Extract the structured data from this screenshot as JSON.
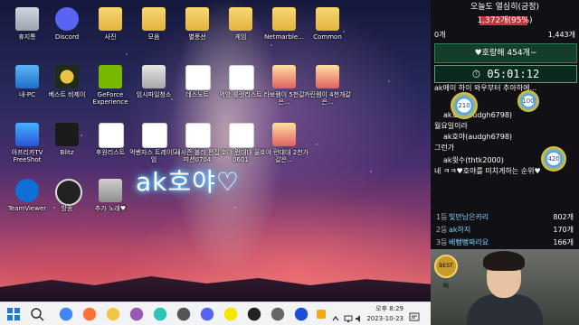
{
  "desktop": {
    "icons": [
      {
        "label": "휴지통",
        "icon": "recycle-bin-icon"
      },
      {
        "label": "Discord",
        "icon": "discord-icon"
      },
      {
        "label": "사진",
        "icon": "folder-icon"
      },
      {
        "label": "모음",
        "icon": "folder-icon"
      },
      {
        "label": "별풍선",
        "icon": "folder-icon"
      },
      {
        "label": "게임",
        "icon": "folder-icon"
      },
      {
        "label": "Netmarble...",
        "icon": "folder-icon"
      },
      {
        "label": "Common",
        "icon": "folder-icon"
      },
      {
        "label": "내-PC",
        "icon": "pc-icon"
      },
      {
        "label": "베스트 비제이",
        "icon": "medal-icon"
      },
      {
        "label": "GeForce Experience",
        "icon": "nvidia-icon"
      },
      {
        "label": "임시파일청소",
        "icon": "trash-icon"
      },
      {
        "label": "데스노트",
        "icon": "document-icon"
      },
      {
        "label": "먹방 룰렛리스트",
        "icon": "document-icon"
      },
      {
        "label": "라보렘이 5천갈은...",
        "icon": "image-icon"
      },
      {
        "label": "카린렘이 4천개갈은...",
        "icon": "image-icon"
      },
      {
        "label": "아프리카TV FreeShot",
        "icon": "pdf-icon"
      },
      {
        "label": "Blitz",
        "icon": "blitz-icon"
      },
      {
        "label": "후원리스트",
        "icon": "document-icon"
      },
      {
        "label": "먹벤자스 트레이모임",
        "icon": "document-icon"
      },
      {
        "label": "새시즌 블러 편집미션0704",
        "icon": "document-icon"
      },
      {
        "label": "호야 런대대 울 0601",
        "icon": "document-icon"
      },
      {
        "label": "호야 런대대 2천가갈은...",
        "icon": "image-icon"
      },
      {
        "label": "TeamViewer",
        "icon": "teamviewer-icon"
      },
      {
        "label": "방송",
        "icon": "obs-icon"
      },
      {
        "label": "추가 노래♥",
        "icon": "file-icon"
      }
    ],
    "overlay_text": "ak호야♡"
  },
  "taskbar": {
    "apps": [
      "windows-start-icon",
      "search-icon",
      "chrome-icon",
      "firefox-icon",
      "folder-icon",
      "kakao-icon",
      "whale-icon",
      "app-icon",
      "discord-icon",
      "kakaotalk-icon",
      "obs-icon",
      "gear-icon",
      "tv-icon"
    ],
    "time": "오후 8:29",
    "date": "2023-10-23"
  },
  "sidebar": {
    "title": "오늘도 열심히(긍정)",
    "progress_label": "1,372개(95%)",
    "progress_fraction": 0.95,
    "range_min": "0개",
    "range_max": "1,443개",
    "banner": "♥호랑해 454개~",
    "timer": "05:01:12",
    "chat": [
      {
        "text": "ak에이 하이 와우부터 추아하에...",
        "kind": "partial"
      },
      {
        "text": "ak호야(audgh6798)",
        "kind": "user"
      },
      {
        "text": "월요일이라",
        "kind": "msg"
      },
      {
        "text": "ak호야(audgh6798)",
        "kind": "user"
      },
      {
        "text": "그런가",
        "kind": "msg"
      },
      {
        "text": "ak윗수(thtk2000)",
        "kind": "user"
      },
      {
        "text": "네 ㅋㅋ♥호야를 미치게하는 순위♥",
        "kind": "msg"
      }
    ],
    "badges": [
      "210",
      "100",
      "420"
    ],
    "ranking": [
      {
        "rank": "1등",
        "name": "빛만남은카리",
        "value": "802개"
      },
      {
        "rank": "2등",
        "name": "ak하지",
        "value": "170개"
      },
      {
        "rank": "3등",
        "name": "베뻥뻥짜라요",
        "value": "166개"
      }
    ],
    "cam_badge": "BEST BJ"
  }
}
